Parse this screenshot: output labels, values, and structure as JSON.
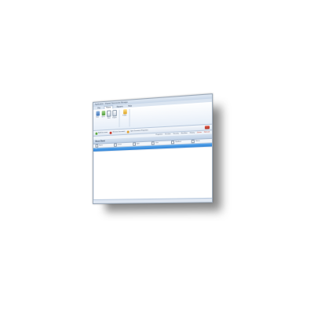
{
  "window": {
    "title": "Application - Shared Documents Manager"
  },
  "ribbon": {
    "tabs": [
      "File",
      "Home",
      "Reports",
      "Help"
    ],
    "active_tab_index": 1,
    "buttons": [
      {
        "label": "New",
        "icon": "new-icon"
      },
      {
        "label": "Open",
        "icon": "open-icon"
      },
      {
        "label": "Save",
        "icon": "save-icon"
      },
      {
        "label": "Export",
        "icon": "export-icon"
      },
      {
        "label": "Folder",
        "icon": "folder-icon"
      }
    ]
  },
  "toolbar": {
    "items": [
      {
        "label": "Add Document",
        "color": "#59a83a"
      },
      {
        "label": "Remove Document",
        "color": "#c8382a"
      },
      {
        "label": "Open Document Properties",
        "color": "#e0a030"
      }
    ]
  },
  "subtabs": [
    "Properties",
    "Versions",
    "Security",
    "Workflow",
    "History"
  ],
  "subtab_red": [
    "Delete",
    "Refresh"
  ],
  "panel": {
    "title": "Base Sheet"
  },
  "grid": {
    "columns": [
      "Name",
      "Owner",
      "Type",
      "Size",
      "Modified",
      "Status"
    ],
    "rows": [
      [
        "1",
        "",
        "",
        "",
        "",
        ""
      ]
    ],
    "selected_row_index": 0
  }
}
